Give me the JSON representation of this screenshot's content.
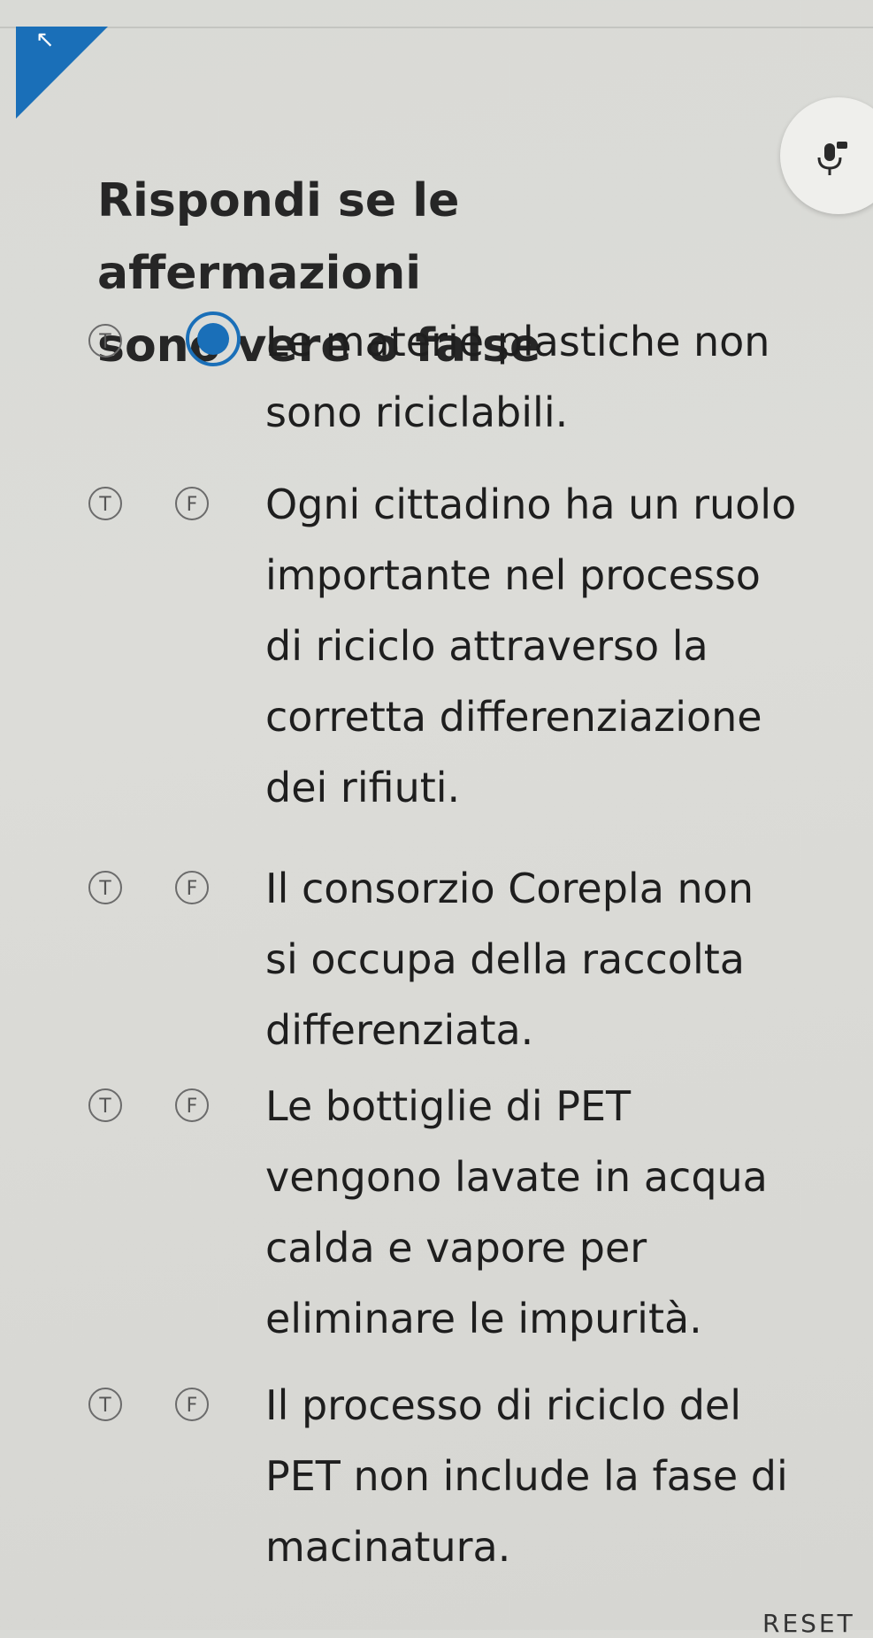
{
  "header": {
    "title": "Rispondi se le affermazioni\nsono vere o false"
  },
  "options": {
    "true_label": "T",
    "false_label": "F"
  },
  "questions": [
    {
      "text": "Le materie plastiche non\nsono riciclabili.",
      "selected": "F"
    },
    {
      "text": "Ogni cittadino ha un ruolo\nimportante nel processo\ndi riciclo attraverso la\ncorretta differenziazione\ndei rifiuti.",
      "selected": null
    },
    {
      "text": "Il consorzio Corepla non\nsi occupa della raccolta\ndifferenziata.",
      "selected": null
    },
    {
      "text": "Le bottiglie di PET\nvengono lavate in acqua\ncalda e vapore per\neliminare le impurità.",
      "selected": null
    },
    {
      "text": "Il processo di riciclo del\nPET non include la fase di\nmacinatura.",
      "selected": null
    }
  ],
  "footer": {
    "reset_label": "RESET"
  },
  "colors": {
    "accent": "#1a6fb8",
    "background": "#dadad6",
    "text": "#1e1e1e"
  }
}
